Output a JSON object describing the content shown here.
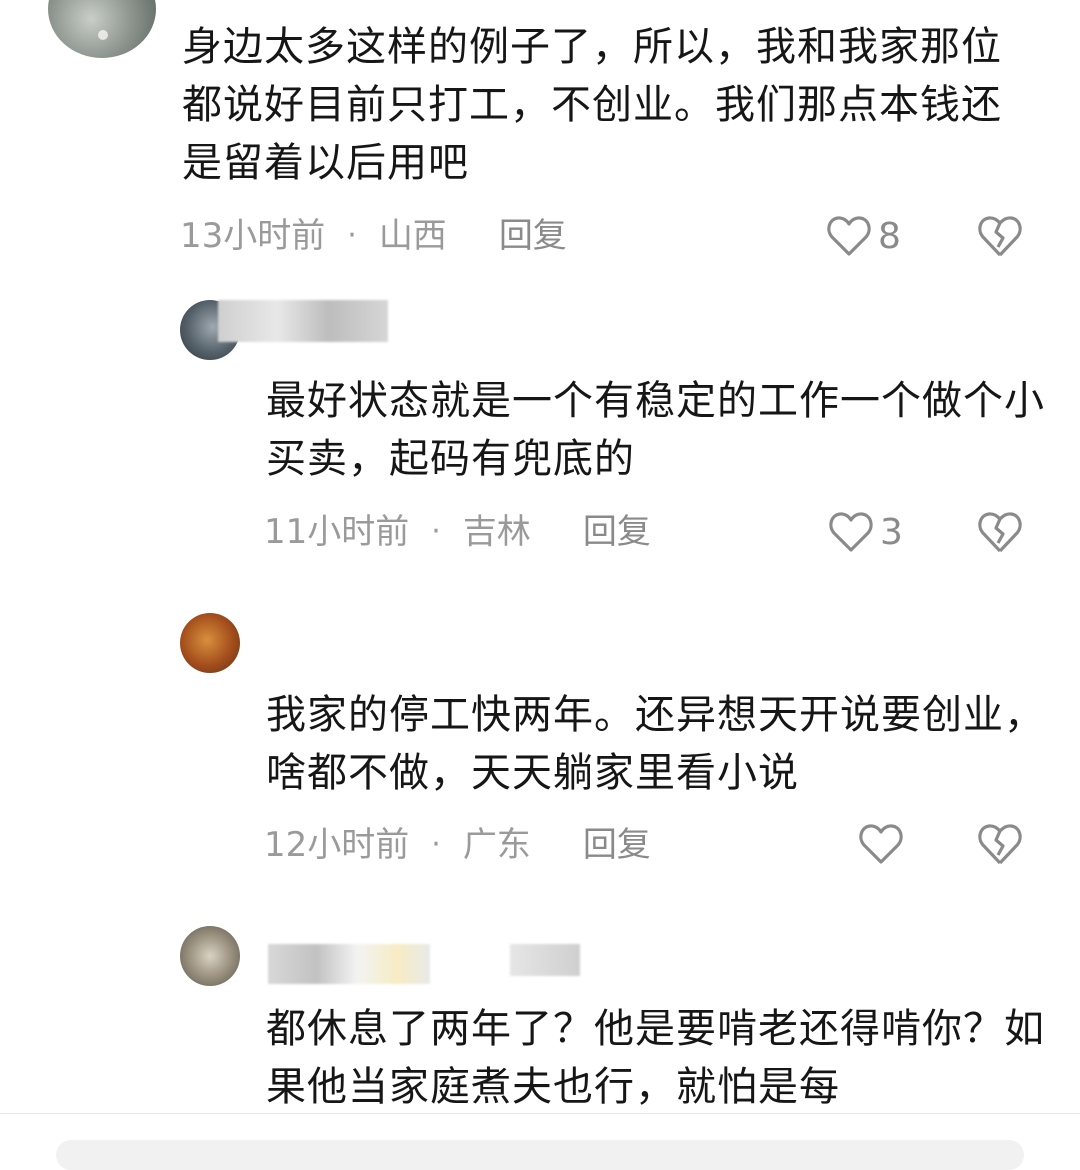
{
  "comments": [
    {
      "text": "身边太多这样的例子了，所以，我和我家那位都说好目前只打工，不创业。我们那点本钱还是留着以后用吧",
      "time": "13小时前",
      "sep": "·",
      "location": "山西",
      "reply": "回复",
      "likes": "8"
    },
    {
      "text": "最好状态就是一个有稳定的工作一个做个小买卖，起码有兜底的",
      "time": "11小时前",
      "sep": "·",
      "location": "吉林",
      "reply": "回复",
      "likes": "3"
    },
    {
      "text": "我家的停工快两年。还异想天开说要创业，啥都不做，天天躺家里看小说",
      "time": "12小时前",
      "sep": "·",
      "location": "广东",
      "reply": "回复",
      "likes": ""
    },
    {
      "text": "都休息了两年了？他是要啃老还得啃你？如果他当家庭煮夫也行，就怕是每"
    }
  ],
  "icons": {
    "like": "heart-outline-icon",
    "dislike": "broken-heart-icon"
  },
  "colors": {
    "text": "#161616",
    "meta": "#9a9a9a"
  }
}
